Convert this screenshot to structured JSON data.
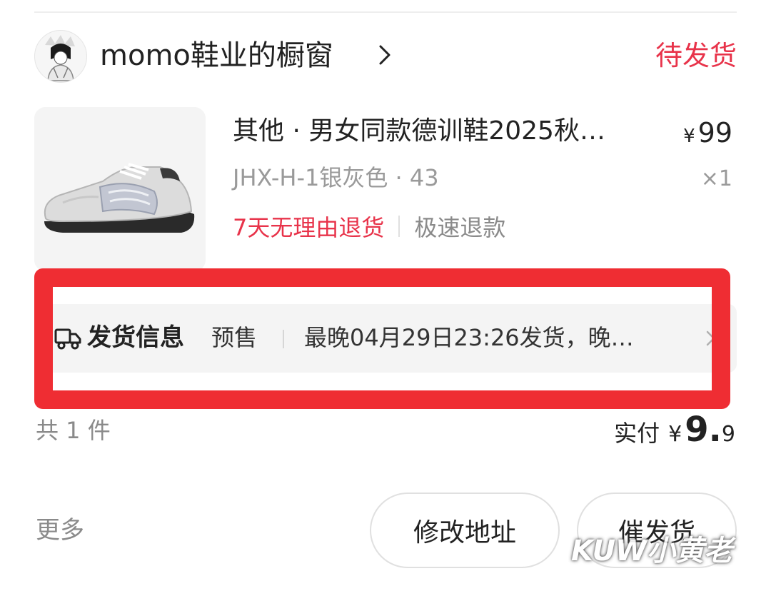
{
  "shop": {
    "name": "momo鞋业的橱窗",
    "status": "待发货"
  },
  "product": {
    "title": "其他 · 男女同款德训鞋2025秋…",
    "price_symbol": "¥",
    "price": "99",
    "variant": "JHX-H-1银灰色 · 43",
    "quantity": "×1",
    "tag_return": "7天无理由退货",
    "tag_refund": "极速退款"
  },
  "shipping": {
    "label": "发货信息",
    "presale": "预售",
    "detail": "最晚04月29日23:26发货，晚…"
  },
  "summary": {
    "count": "共 1 件",
    "paid_label": "实付",
    "currency": "¥",
    "paid_int": "9.",
    "paid_dec": "9"
  },
  "actions": {
    "more": "更多",
    "modify_address": "修改地址",
    "urge_ship": "催发货"
  },
  "watermark": "KUW小黄老",
  "colors": {
    "accent_red": "#e8334a",
    "highlight_red": "#ef2d33",
    "muted_gray": "#9a9a9a"
  }
}
